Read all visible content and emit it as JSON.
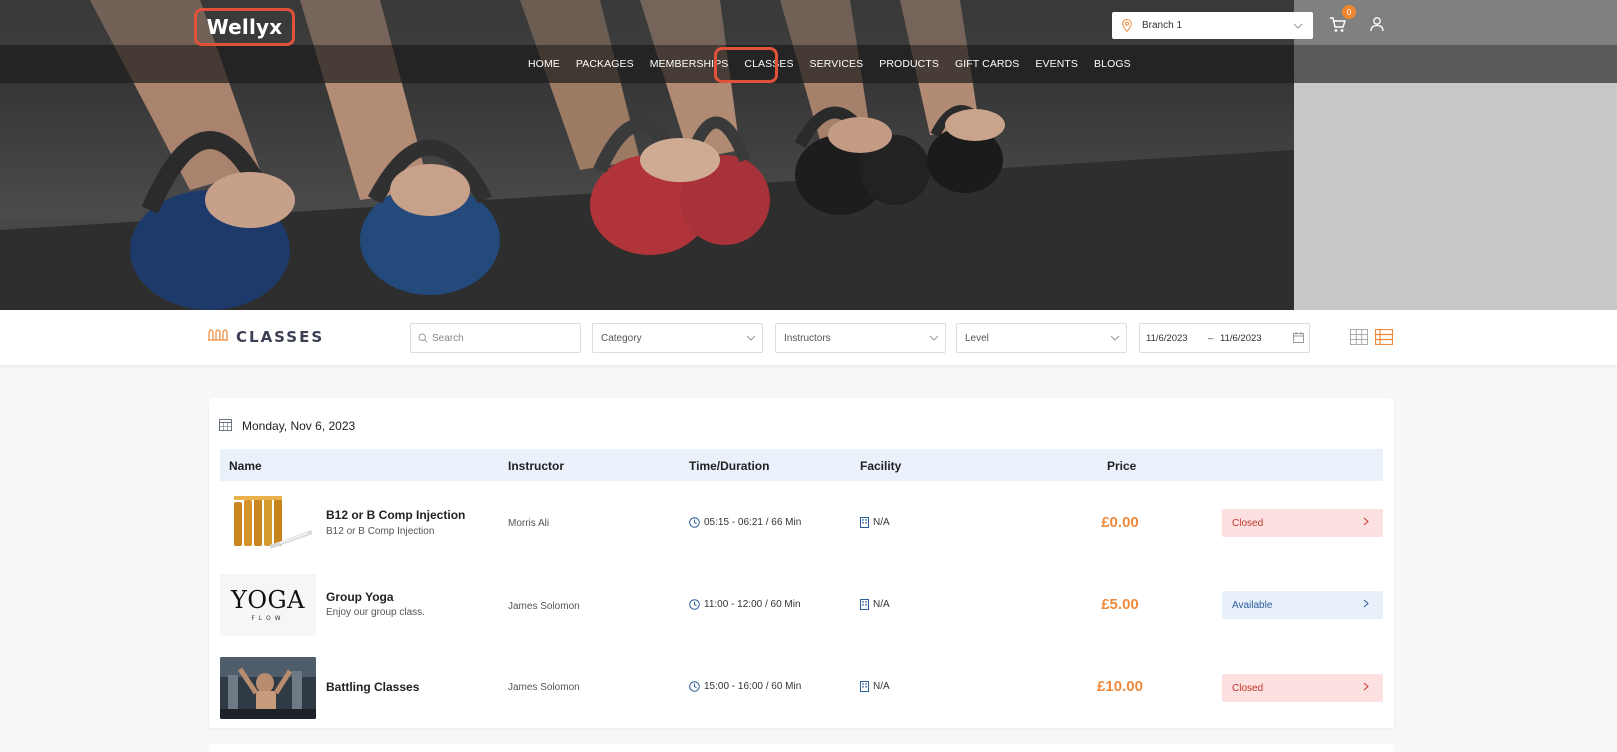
{
  "header": {
    "logo": "Wellyx",
    "nav": [
      "HOME",
      "PACKAGES",
      "MEMBERSHIPS",
      "CLASSES",
      "SERVICES",
      "PRODUCTS",
      "GIFT CARDS",
      "EVENTS",
      "BLOGS"
    ],
    "active_nav": "CLASSES",
    "branch_select": "Branch 1",
    "cart_count": "0"
  },
  "filters": {
    "title": "CLASSES",
    "search_placeholder": "Search",
    "category": "Category",
    "instructors": "Instructors",
    "level": "Level",
    "date_from": "11/6/2023",
    "date_separator": "–",
    "date_to": "11/6/2023"
  },
  "schedule": {
    "date": "Monday, Nov 6, 2023",
    "columns": {
      "name": "Name",
      "instructor": "Instructor",
      "time": "Time/Duration",
      "facility": "Facility",
      "price": "Price"
    },
    "rows": [
      {
        "name": "B12 or B Comp Injection",
        "subtitle": "B12 or B Comp Injection",
        "instructor": "Morris Ali",
        "time": "05:15 - 06:21 / 66 Min",
        "facility": "N/A",
        "price": "£0.00",
        "status": "Closed",
        "image": "vials-image"
      },
      {
        "name": "Group Yoga",
        "subtitle": "Enjoy our group class.",
        "instructor": "James Solomon",
        "time": "11:00 - 12:00 / 60 Min",
        "facility": "N/A",
        "price": "£5.00",
        "status": "Available",
        "image": "yoga-flow-logo",
        "image_text": "YOGA",
        "image_subtext": "FLOW"
      },
      {
        "name": "Battling Classes",
        "subtitle": "",
        "instructor": "James Solomon",
        "time": "15:00 - 16:00 / 60 Min",
        "facility": "N/A",
        "price": "£10.00",
        "status": "Closed",
        "image": "battling-class-photo"
      }
    ]
  },
  "colors": {
    "accent": "#ef8a3d",
    "highlight": "#e0523a",
    "closed_bg": "#fde0e0",
    "available_bg": "#e8f0fa",
    "header_row_bg": "#eaf1fb"
  }
}
